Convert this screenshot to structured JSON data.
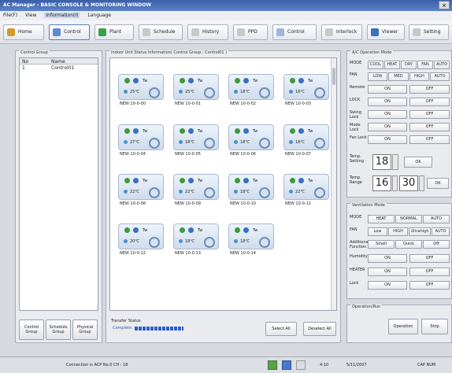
{
  "window": {
    "title": "AC Manager - BASIC CONSOLE & MONITORING WINDOW",
    "close_glyph": "×"
  },
  "menu": [
    "File(F)",
    "View",
    "Information(I)",
    "Language"
  ],
  "toolbar": [
    {
      "label": "Home",
      "icon": "home-icon",
      "color": "#d79b2a"
    },
    {
      "label": "Control",
      "icon": "control-icon",
      "color": "#5b8bd0"
    },
    {
      "label": "Plant",
      "icon": "plant-icon",
      "color": "#3aa04a"
    },
    {
      "label": "Schedule",
      "icon": "schedule-icon",
      "color": "#c8c8c8"
    },
    {
      "label": "History",
      "icon": "history-icon",
      "color": "#c8c8c8"
    },
    {
      "label": "PPD",
      "icon": "ppd-icon",
      "color": "#c8c8c8"
    },
    {
      "label": "Control",
      "icon": "control2-icon",
      "color": "#9fb7dc"
    },
    {
      "label": "Interlock",
      "icon": "interlock-icon",
      "color": "#c8c8c8"
    },
    {
      "label": "Viewer",
      "icon": "viewer-icon",
      "color": "#3b6fc0"
    },
    {
      "label": "Setting",
      "icon": "setting-icon",
      "color": "#c8c8c8"
    }
  ],
  "control_group": {
    "legend": "Control Group",
    "headers": [
      "No",
      "Name"
    ],
    "rows": [
      {
        "no": "1",
        "name": "Control01"
      }
    ],
    "buttons": [
      "Control Group",
      "Schedule Group",
      "Physical Group"
    ]
  },
  "indoor": {
    "legend": "Indoor Unit Status Information( Control Group : Control01 )",
    "units": [
      {
        "id": "1",
        "temp": "25℃",
        "label": "NEW 10-0-00"
      },
      {
        "id": "2",
        "temp": "25℃",
        "label": "NEW 10-0-01"
      },
      {
        "id": "3",
        "temp": "18℃",
        "label": "NEW 10-0-02"
      },
      {
        "id": "4",
        "temp": "18℃",
        "label": "NEW 10-0-03"
      },
      {
        "id": "5",
        "temp": "27℃",
        "label": "NEW 10-0-04"
      },
      {
        "id": "6",
        "temp": "18℃",
        "label": "NEW 10-0-05"
      },
      {
        "id": "7",
        "temp": "18℃",
        "label": "NEW 10-0-06"
      },
      {
        "id": "8",
        "temp": "18℃",
        "label": "NEW 10-0-07"
      },
      {
        "id": "9",
        "temp": "22℃",
        "label": "NEW 10-0-08"
      },
      {
        "id": "10",
        "temp": "22℃",
        "label": "NEW 10-0-09"
      },
      {
        "id": "11",
        "temp": "18℃",
        "label": "NEW 10-0-10"
      },
      {
        "id": "12",
        "temp": "22℃",
        "label": "NEW 10-0-11"
      },
      {
        "id": "13",
        "temp": "20℃",
        "label": "NEW 10-0-12"
      },
      {
        "id": "14",
        "temp": "18℃",
        "label": "NEW 10-0-13"
      },
      {
        "id": "15",
        "temp": "18℃",
        "label": "NEW 10-0-14"
      }
    ],
    "unit_tag": "Tw",
    "transfer_legend": "Transfer Status",
    "transfer_text": "Complete",
    "progress": 1.0,
    "select_all": "Select All",
    "deselect_all": "Deselect All"
  },
  "ac_mode": {
    "legend": "A/C Operation Mode",
    "mode_caption": "MODE",
    "modes": [
      "COOL",
      "HEAT",
      "DRY",
      "FAN",
      "AUTO"
    ],
    "fan_caption": "FAN",
    "fans": [
      "LOW",
      "MED",
      "HIGH",
      "AUTO"
    ],
    "rows": [
      {
        "caption": "Remote",
        "on": "ON",
        "off": "OFF"
      },
      {
        "caption": "LOCK",
        "on": "ON",
        "off": "OFF"
      },
      {
        "caption": "Swing Lock",
        "on": "ON",
        "off": "OFF"
      },
      {
        "caption": "Mode Lock",
        "on": "ON",
        "off": "OFF"
      },
      {
        "caption": "Fan Lock",
        "on": "ON",
        "off": "OFF"
      }
    ],
    "temp_setting_caption": "Temp. Setting",
    "temp_setting": "18",
    "temp_setting_btn": "OK",
    "temp_range_caption": "Temp. Range",
    "temp_low": "16",
    "temp_high": "30",
    "temp_range_btn": "OK"
  },
  "ventilation": {
    "legend": "Ventilation Mode",
    "mode_caption": "MODE",
    "modes": [
      "HEAT",
      "NORMAL",
      "AUTO"
    ],
    "fan_caption": "FAN",
    "fans": [
      "Low",
      "HIGH",
      "Ultrahigh",
      "AUTO"
    ],
    "additional_caption": "Additional Function",
    "additional": [
      "Smell",
      "Quick",
      "Off"
    ],
    "rows": [
      {
        "caption": "Humidity",
        "on": "ON",
        "off": "OFF"
      },
      {
        "caption": "HEATER",
        "on": "ON",
        "off": "OFF"
      },
      {
        "caption": "Lock",
        "on": "ON",
        "off": "OFF"
      }
    ]
  },
  "op_run": {
    "legend": "Operation/Run",
    "operation": "Operation",
    "stop": "Stop"
  },
  "status": {
    "connection": "Connection is ACP No.0 CH : 18",
    "time": "4:10",
    "date": "5/11/2007",
    "keyboard": "CAP  NUM"
  }
}
